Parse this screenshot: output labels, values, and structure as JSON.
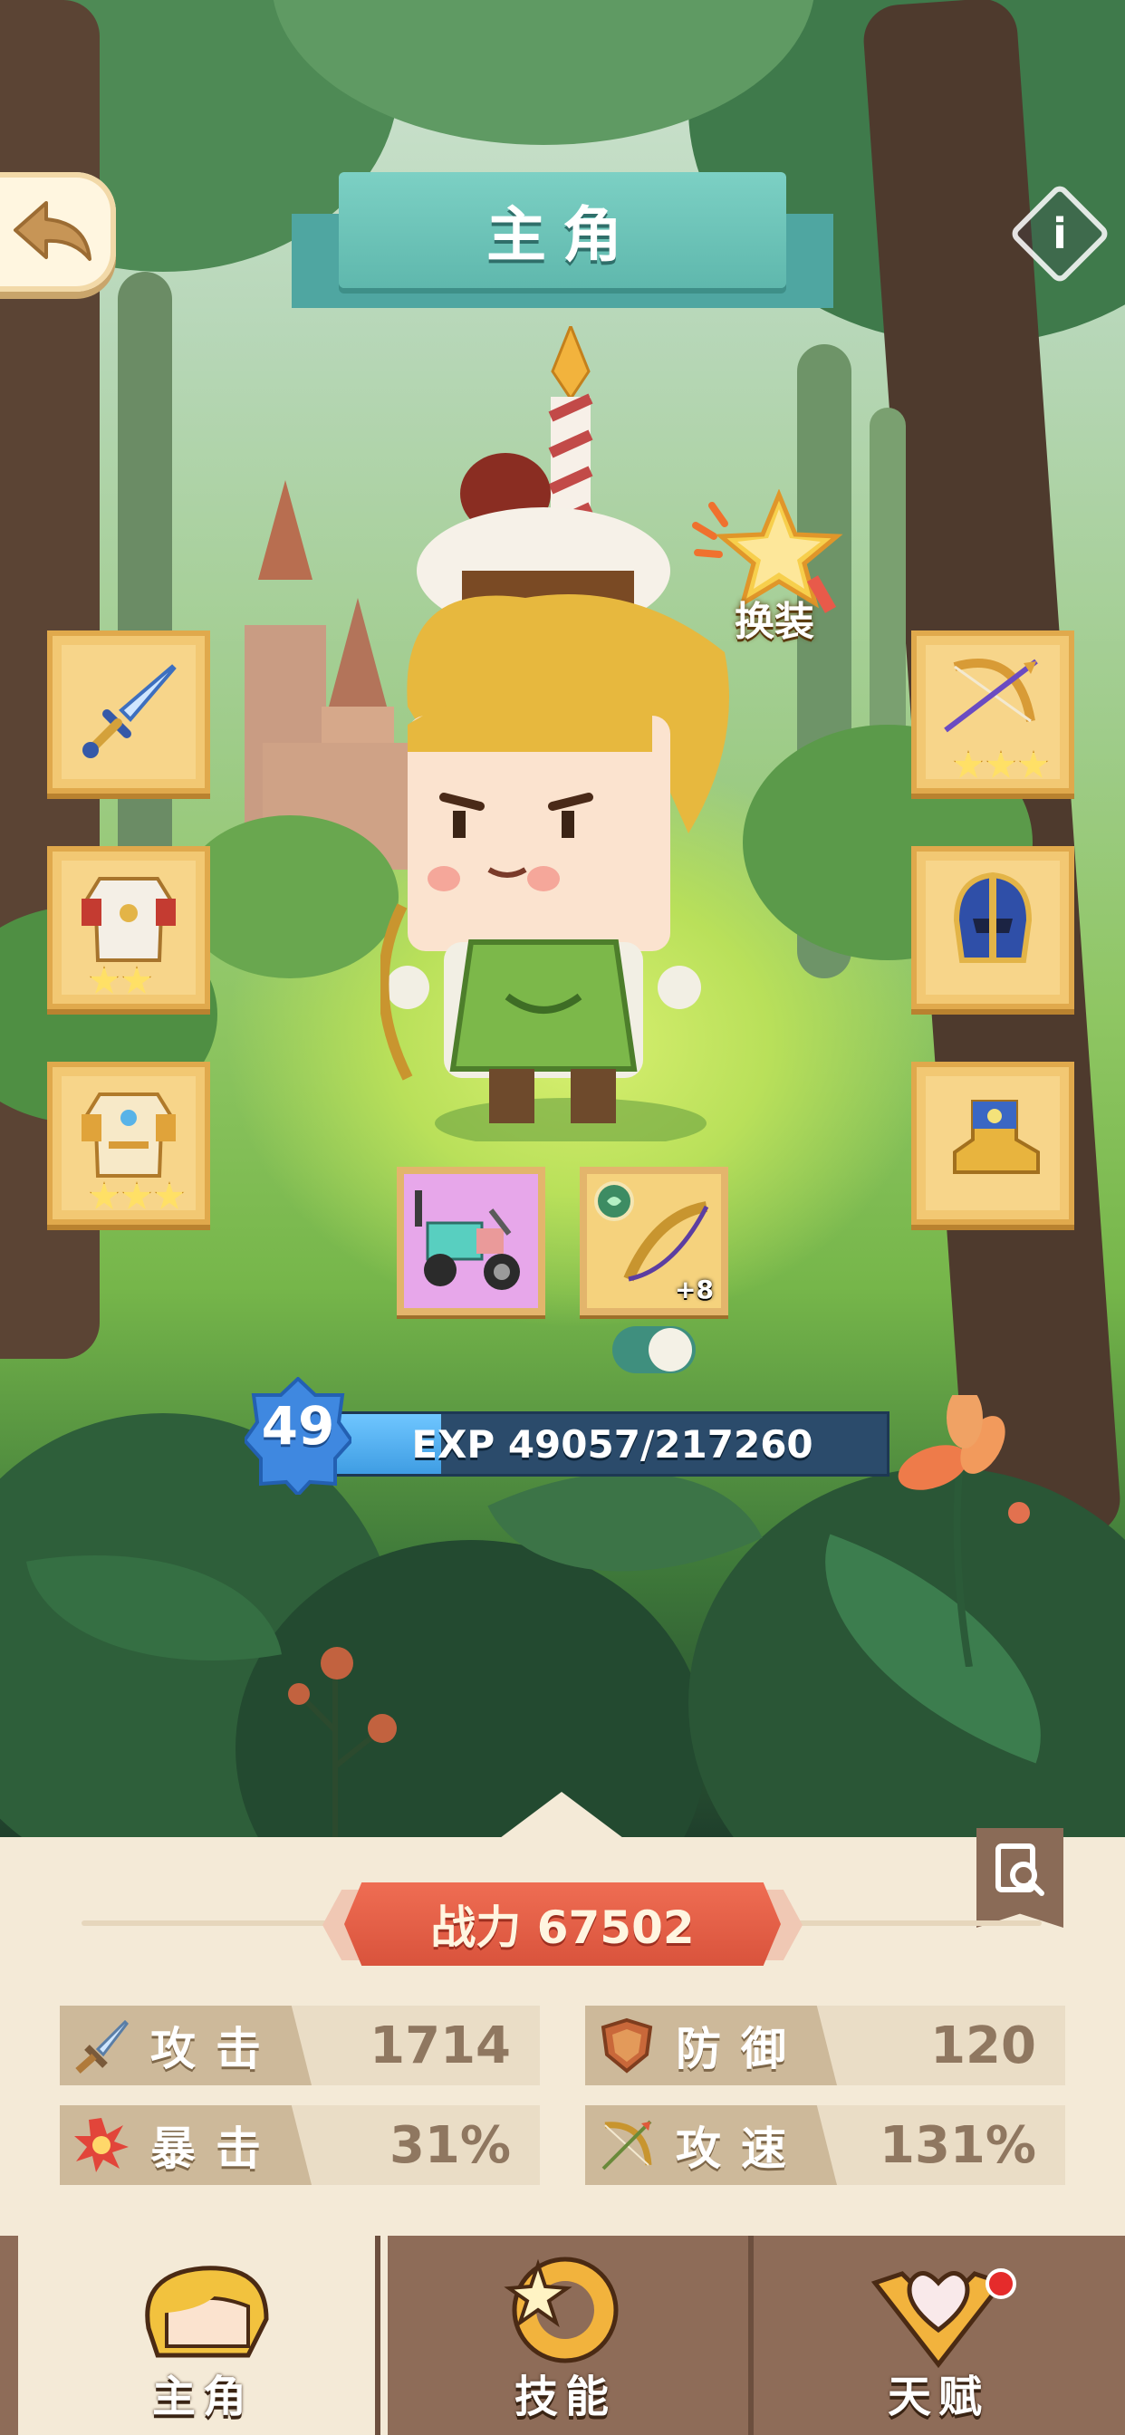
{
  "header": {
    "title": "主角"
  },
  "outfit": {
    "label": "换装"
  },
  "equipment": {
    "left": [
      {
        "icon": "sword-icon",
        "stars": 0
      },
      {
        "icon": "armor-icon",
        "stars": 2
      },
      {
        "icon": "armor-gold-icon",
        "stars": 3
      }
    ],
    "right": [
      {
        "icon": "bow-icon",
        "stars": 3
      },
      {
        "icon": "helmet-icon",
        "stars": 0
      },
      {
        "icon": "boots-icon",
        "stars": 0
      }
    ],
    "mount_icon": "motorcycle-icon",
    "weapon_icon": "bow-weapon-icon",
    "weapon_enhance": "+8"
  },
  "level": {
    "value": "49",
    "exp_text": "EXP 49057/217260",
    "exp_current": 49057,
    "exp_max": 217260
  },
  "power": {
    "text": "战力 67502"
  },
  "stats": [
    {
      "icon": "sword-stat-icon",
      "label": "攻击",
      "value": "1714"
    },
    {
      "icon": "shield-stat-icon",
      "label": "防御",
      "value": "120"
    },
    {
      "icon": "explosion-stat-icon",
      "label": "暴击",
      "value": "31%"
    },
    {
      "icon": "bow-stat-icon",
      "label": "攻速",
      "value": "131%"
    }
  ],
  "nav": [
    {
      "label": "主角",
      "icon": "hero-face-icon",
      "active": true
    },
    {
      "label": "技能",
      "icon": "skill-icon",
      "active": false
    },
    {
      "label": "天赋",
      "icon": "talent-heart-icon",
      "active": false
    }
  ],
  "colors": {
    "title_teal": "#5fb8ad",
    "power_red": "#d9533c",
    "slot_gold": "#f2c873",
    "exp_blue": "#3f9de3",
    "notification_red": "#e52b2b"
  }
}
